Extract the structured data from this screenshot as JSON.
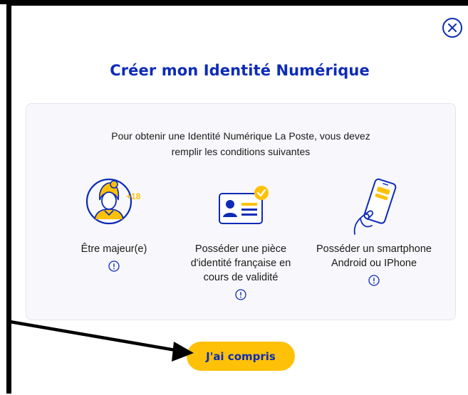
{
  "dialog": {
    "title": "Créer mon Identité Numérique",
    "intro_line1": "Pour obtenir une Identité Numérique La Poste, vous devez",
    "intro_line2": "remplir les conditions suivantes",
    "conditions": [
      {
        "icon": "adult-person-icon",
        "badge": "+18",
        "lines": [
          "Être majeur(e)"
        ]
      },
      {
        "icon": "id-card-check-icon",
        "lines": [
          "Posséder une pièce",
          "d'identité française en",
          "cours de validité"
        ]
      },
      {
        "icon": "smartphone-hand-icon",
        "lines": [
          "Posséder un smartphone",
          "Android ou IPhone"
        ]
      }
    ],
    "confirm_label": "J'ai compris",
    "close_icon": "close-icon"
  },
  "colors": {
    "brand_blue": "#0d2bb8",
    "accent_yellow": "#ffc107",
    "card_background": "#f8f8fc"
  }
}
